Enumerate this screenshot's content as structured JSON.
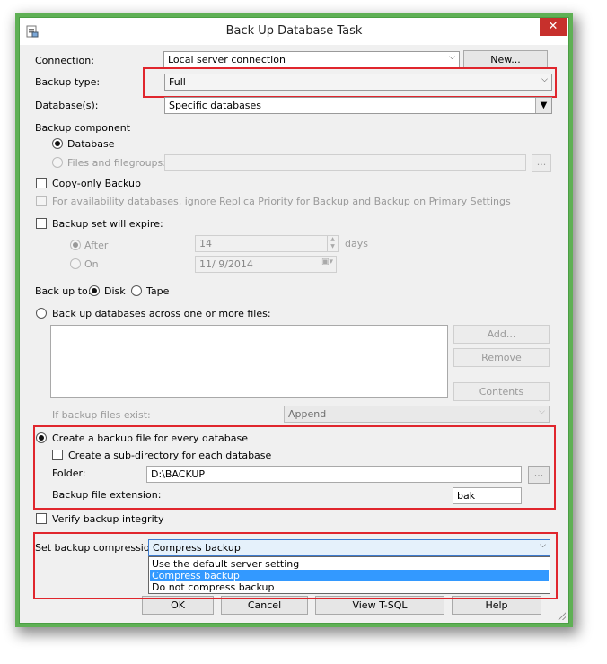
{
  "window": {
    "title": "Back Up Database Task",
    "close_glyph": "✕"
  },
  "connection": {
    "label": "Connection:",
    "value": "Local server connection",
    "new_button": "New..."
  },
  "backup_type": {
    "label": "Backup type:",
    "value": "Full"
  },
  "databases": {
    "label": "Database(s):",
    "value": "Specific databases"
  },
  "backup_component": {
    "label": "Backup component",
    "database_option": "Database",
    "files_option": "Files and filegroups:",
    "browse": "..."
  },
  "copy_only": "Copy-only Backup",
  "availability": "For availability databases, ignore Replica Priority for Backup and Backup on Primary Settings",
  "expire": {
    "label": "Backup set will expire:",
    "after_label": "After",
    "after_value": "14",
    "after_unit": "days",
    "on_label": "On",
    "on_value": "11/  9/2014"
  },
  "backup_to": {
    "label": "Back up to:",
    "disk": "Disk",
    "tape": "Tape"
  },
  "across_files": {
    "label": "Back up databases across one or more files:",
    "add_button": "Add...",
    "remove_button": "Remove",
    "contents_button": "Contents",
    "if_exist_label": "If backup files exist:",
    "if_exist_value": "Append"
  },
  "per_database": {
    "label": "Create a backup file for every database",
    "subdir_label": "Create a sub-directory for each database",
    "folder_label": "Folder:",
    "folder_value": "D:\\BACKUP",
    "browse": "...",
    "extension_label": "Backup file extension:",
    "extension_value": "bak"
  },
  "verify": "Verify backup integrity",
  "compression": {
    "label": "Set backup compression:",
    "value": "Compress backup",
    "options": [
      "Use the default server setting",
      "Compress backup",
      "Do not compress backup"
    ],
    "selected_index": 1
  },
  "footer": {
    "ok": "OK",
    "cancel": "Cancel",
    "view_tsql": "View T-SQL",
    "help": "Help"
  },
  "colors": {
    "highlight_red": "#e0262d",
    "selection_blue": "#3399ff",
    "window_border_green": "#5fb055",
    "close_red": "#c7302c"
  }
}
